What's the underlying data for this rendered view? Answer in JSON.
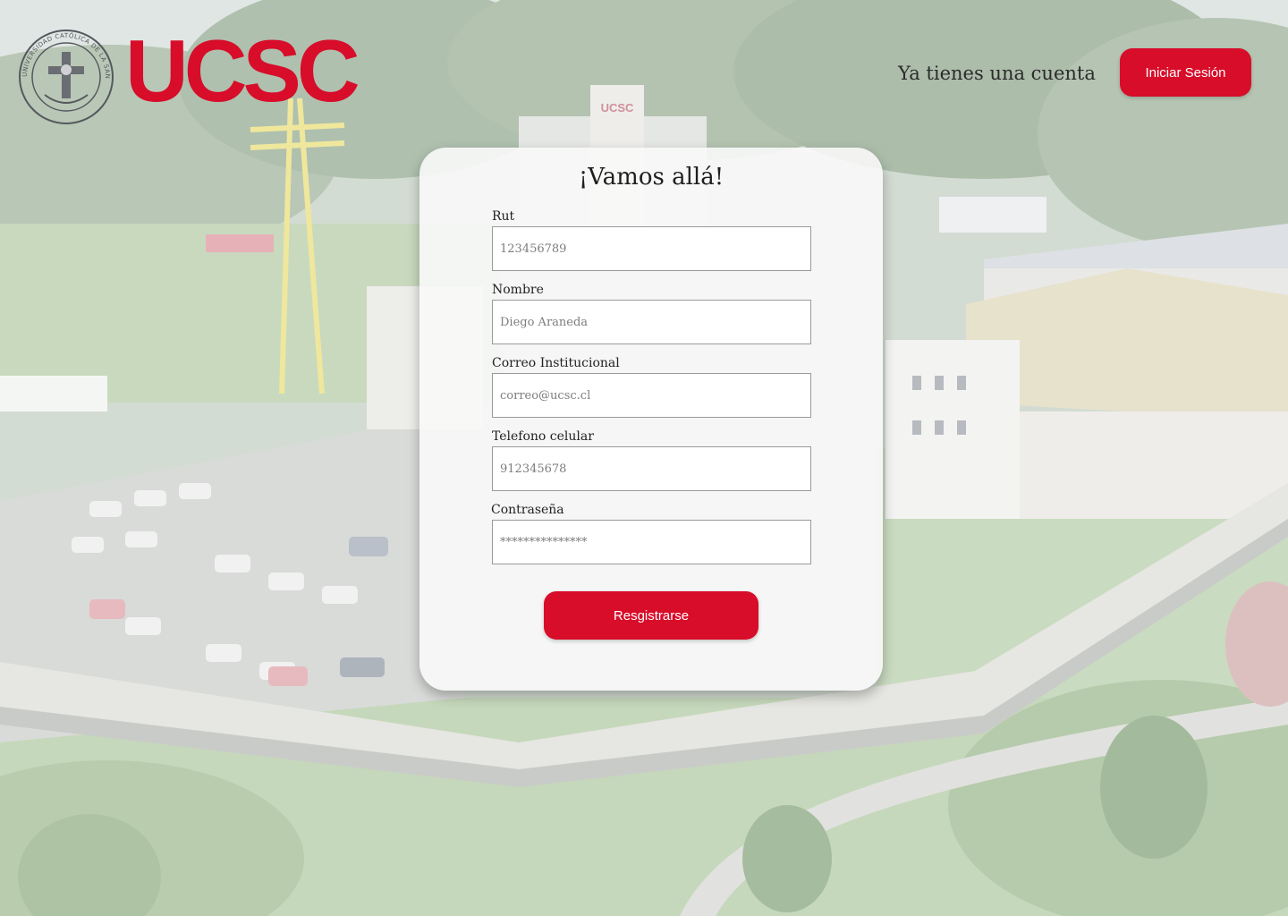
{
  "brand": {
    "wordmark": "UCSC",
    "seal_text": "UNIVERSIDAD CATÓLICA DE LA SANTÍSIMA CONCEPCIÓN",
    "accent_color": "#d70d2a"
  },
  "header": {
    "account_prompt": "Ya tienes una cuenta",
    "login_label": "Iniciar Sesión"
  },
  "form": {
    "title": "¡Vamos allá!",
    "fields": [
      {
        "label": "Rut",
        "placeholder": "123456789",
        "type": "text"
      },
      {
        "label": "Nombre",
        "placeholder": "Diego Araneda",
        "type": "text"
      },
      {
        "label": "Correo Institucional",
        "placeholder": "correo@ucsc.cl",
        "type": "email"
      },
      {
        "label": "Telefono celular",
        "placeholder": "912345678",
        "type": "tel"
      },
      {
        "label": "Contraseña",
        "placeholder": "***************",
        "type": "password"
      }
    ],
    "submit_label": "Resgistrarse"
  },
  "background": {
    "tower_sign": "UCSC"
  }
}
